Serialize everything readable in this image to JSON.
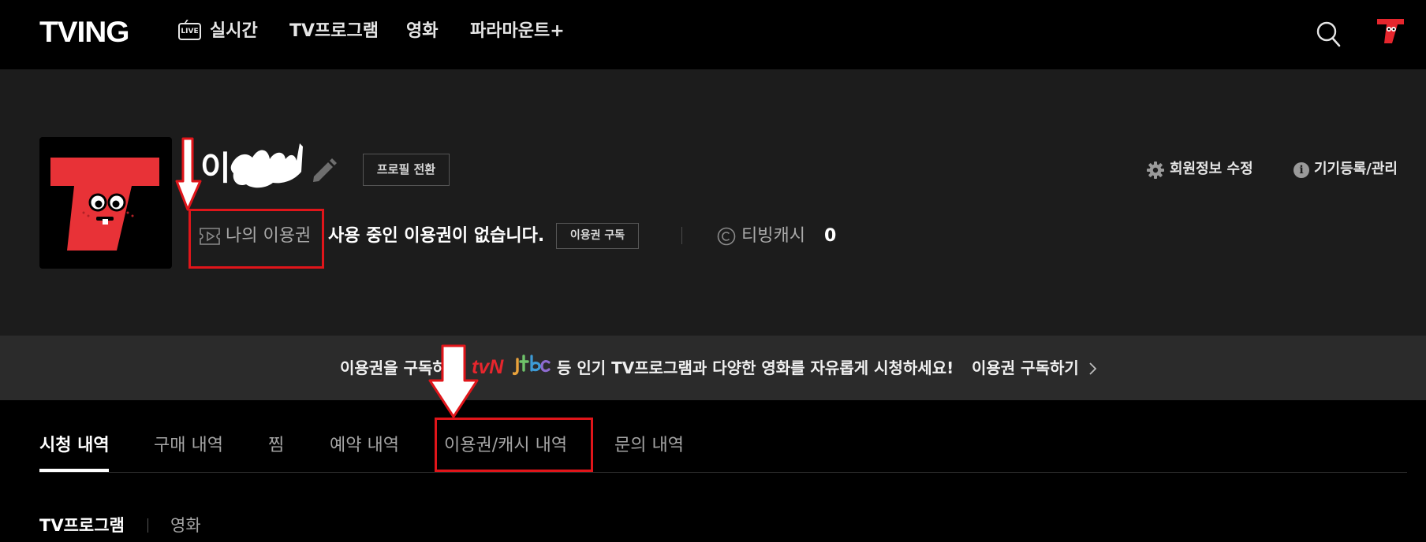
{
  "header": {
    "logo": "TVING",
    "nav": [
      {
        "label": "실시간",
        "badge": "LIVE"
      },
      {
        "label": "TV프로그램"
      },
      {
        "label": "영화"
      },
      {
        "label": "파라마운트+"
      }
    ],
    "icons": [
      "search-icon",
      "profile-avatar-icon"
    ]
  },
  "profile": {
    "name": "이",
    "switch_button": "프로필 전환",
    "ticket_label": "나의 이용권",
    "ticket_status": "사용 중인 이용권이 없습니다.",
    "subscribe_button": "이용권 구독",
    "cash_label": "티빙캐시",
    "cash_value": "0",
    "edit_member": "회원정보 수정",
    "device_manage": "기기등록/관리"
  },
  "banner": {
    "text_before": "이용권을 구독하고",
    "brand1": "tvN",
    "brand2": "jtbc",
    "text_after": "등 인기 TV프로그램과 다양한 영화를 자유롭게 시청하세요!",
    "cta": "이용권 구독하기"
  },
  "tabs": [
    {
      "label": "시청 내역",
      "active": true
    },
    {
      "label": "구매 내역"
    },
    {
      "label": "찜"
    },
    {
      "label": "예약 내역"
    },
    {
      "label": "이용권/캐시 내역"
    },
    {
      "label": "문의 내역"
    }
  ],
  "subtabs": [
    {
      "label": "TV프로그램",
      "active": true
    },
    {
      "label": "영화"
    }
  ],
  "colors": {
    "background": "#000000",
    "profile_bg": "#1c1c1c",
    "banner_bg": "#2b2b2b",
    "brand_red": "#e6262d",
    "annotation_red": "#e0151a"
  }
}
